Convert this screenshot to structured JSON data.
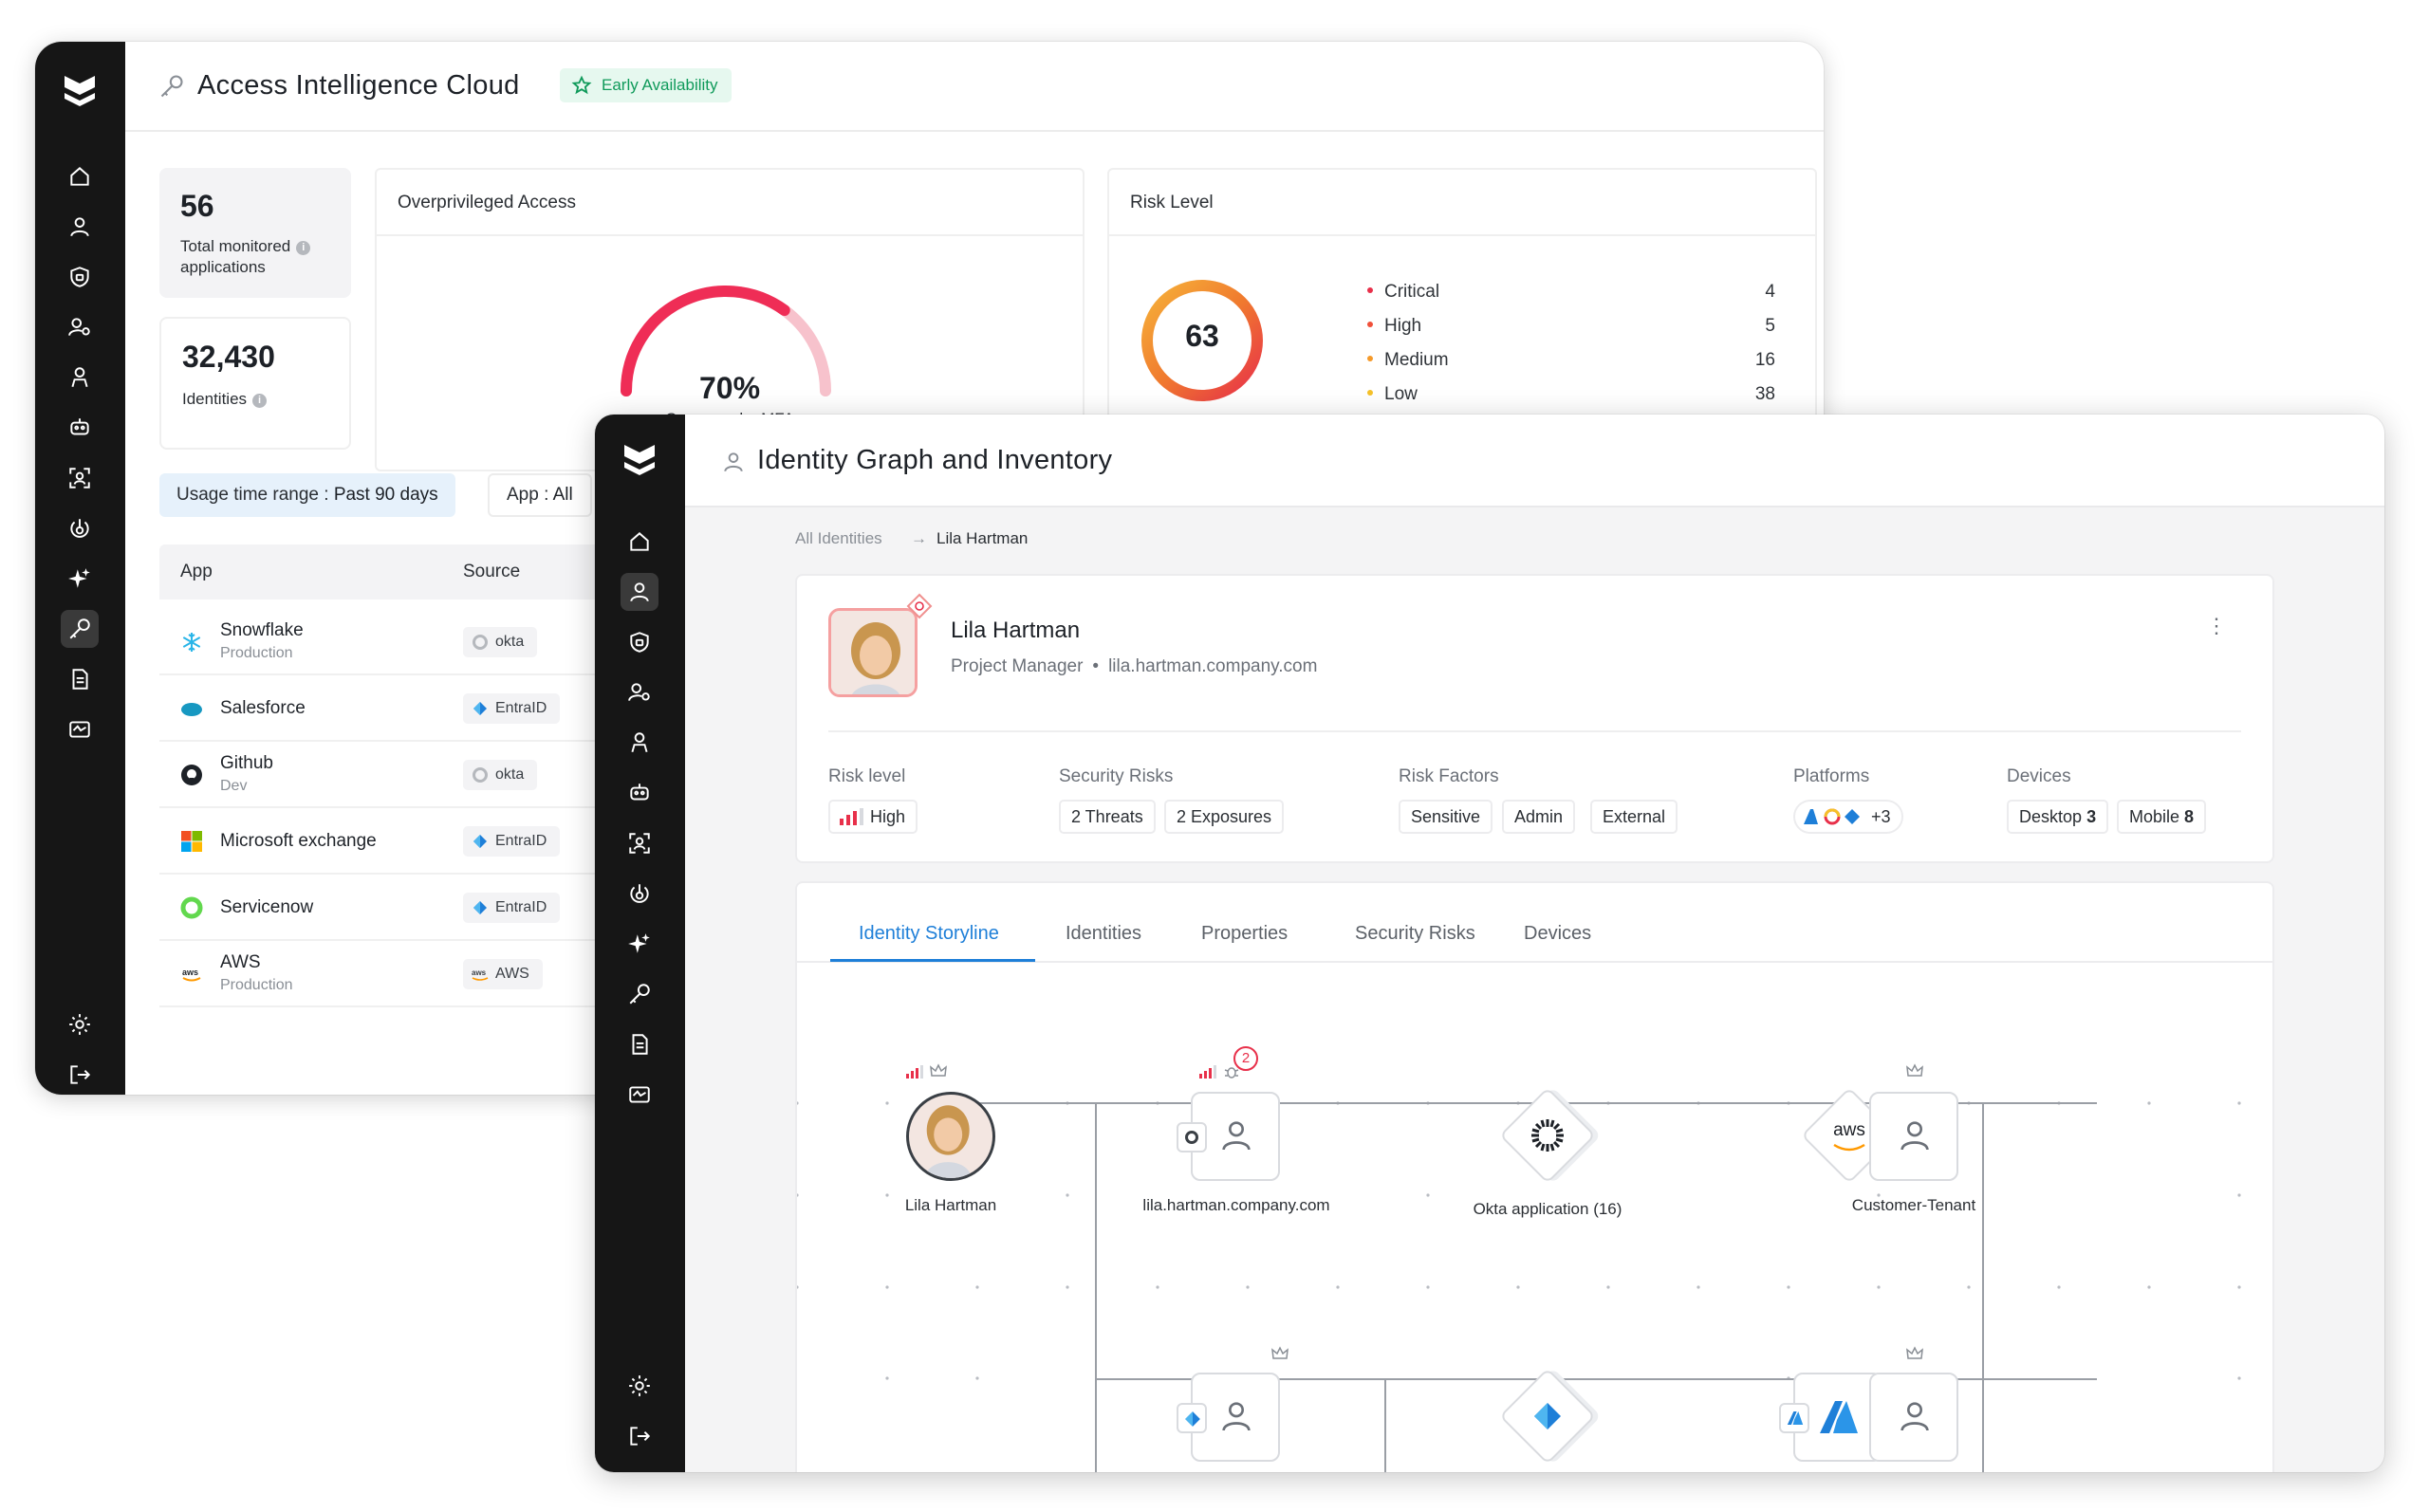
{
  "colors": {
    "sidebar": "#161616",
    "accent_blue": "#1e7fd8",
    "badge_green": "#0f9a5a",
    "risk_red": "#e8304a"
  },
  "window_a": {
    "title": "Access Intelligence Cloud",
    "badge": "Early Availability",
    "stats": [
      {
        "value": "56",
        "label_line1": "Total monitored",
        "label_line2": "applications"
      },
      {
        "value": "32,430",
        "label": "Identities"
      }
    ],
    "overprivileged": {
      "title": "Overprivileged Access",
      "percent": "70%",
      "caption": "Coverage by MFA",
      "coverage_fraction": 0.7
    },
    "risk_level": {
      "title": "Risk Level",
      "score": "63",
      "rows": [
        {
          "label": "Critical",
          "count": "4",
          "color": "#e8304a"
        },
        {
          "label": "High",
          "count": "5",
          "color": "#f0503a"
        },
        {
          "label": "Medium",
          "count": "16",
          "color": "#f59a2a"
        },
        {
          "label": "Low",
          "count": "38",
          "color": "#f5c12a"
        }
      ]
    },
    "filters": {
      "usage_label": "Usage time range :",
      "usage_value": "Past 90 days",
      "app_label": "App :",
      "app_value": "All"
    },
    "table": {
      "headers": [
        "App",
        "Source"
      ],
      "rows": [
        {
          "name": "Snowflake",
          "sub": "Production",
          "source": "okta",
          "icon": "snowflake-icon"
        },
        {
          "name": "Salesforce",
          "sub": "",
          "source": "EntraID",
          "icon": "salesforce-icon"
        },
        {
          "name": "Github",
          "sub": "Dev",
          "source": "okta",
          "icon": "github-icon"
        },
        {
          "name": "Microsoft exchange",
          "sub": "",
          "source": "EntraID",
          "icon": "microsoft-icon"
        },
        {
          "name": "Servicenow",
          "sub": "",
          "source": "EntraID",
          "icon": "servicenow-icon"
        },
        {
          "name": "AWS",
          "sub": "Production",
          "source": "AWS",
          "icon": "aws-icon"
        }
      ]
    }
  },
  "window_b": {
    "title": "Identity Graph and Inventory",
    "breadcrumb": {
      "parent": "All Identities",
      "current": "Lila Hartman"
    },
    "profile": {
      "name": "Lila Hartman",
      "role": "Project Manager",
      "email": "lila.hartman.company.com",
      "sections": {
        "risk_level": {
          "label": "Risk level",
          "value": "High"
        },
        "security_risks": {
          "label": "Security Risks",
          "chips": [
            "2 Threats",
            "2 Exposures"
          ]
        },
        "risk_factors": {
          "label": "Risk Factors",
          "chips": [
            "Sensitive",
            "Admin",
            "External"
          ]
        },
        "platforms": {
          "label": "Platforms",
          "extra": "+3"
        },
        "devices": {
          "label": "Devices",
          "chips": [
            {
              "name": "Desktop",
              "count": "3"
            },
            {
              "name": "Mobile",
              "count": "8"
            }
          ]
        }
      }
    },
    "tabs": [
      "Identity Storyline",
      "Identities",
      "Properties",
      "Security Risks",
      "Devices"
    ],
    "graph": {
      "nodes": [
        "Lila Hartman",
        "lila.hartman.company.com",
        "Okta application (16)",
        "aws",
        "Customer-Tenant"
      ],
      "alert_count": "2"
    }
  }
}
